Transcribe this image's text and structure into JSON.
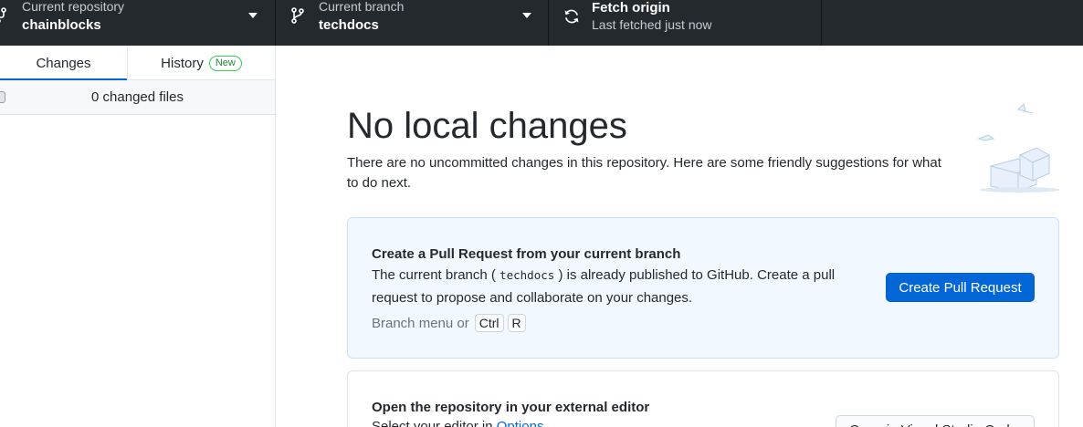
{
  "toolbar": {
    "repository": {
      "label": "Current repository",
      "value": "chainblocks",
      "icon": "repo-icon"
    },
    "branch": {
      "label": "Current branch",
      "value": "techdocs",
      "icon": "git-branch-icon"
    },
    "fetch": {
      "title": "Fetch origin",
      "status": "Last fetched just now",
      "icon": "sync-icon"
    }
  },
  "sidebar": {
    "tabs": [
      {
        "label": "Changes",
        "active": true
      },
      {
        "label": "History",
        "badge": "New",
        "active": false
      }
    ],
    "changed_files": "0 changed files"
  },
  "main": {
    "heading": "No local changes",
    "intro": "There are no uncommitted changes in this repository. Here are some friendly suggestions for what to do next.",
    "pull_request_card": {
      "title": "Create a Pull Request from your current branch",
      "desc_before": "The current branch (",
      "branch_code": "techdocs",
      "desc_after": ") is already published to GitHub. Create a pull request to propose and collaborate on your changes.",
      "hint_prefix": "Branch menu or",
      "shortcut_keys": [
        "Ctrl",
        "R"
      ],
      "button": "Create Pull Request"
    },
    "editor_card": {
      "title": "Open the repository in your external editor",
      "desc_prefix": "Select your editor in",
      "desc_link": "Options",
      "button": "Open in Visual Studio Code"
    }
  },
  "colors": {
    "toolbar_bg": "#24292e",
    "accent": "#0366d6",
    "card_blue_bg": "#f1f8ff",
    "badge_green": "#22863a"
  }
}
